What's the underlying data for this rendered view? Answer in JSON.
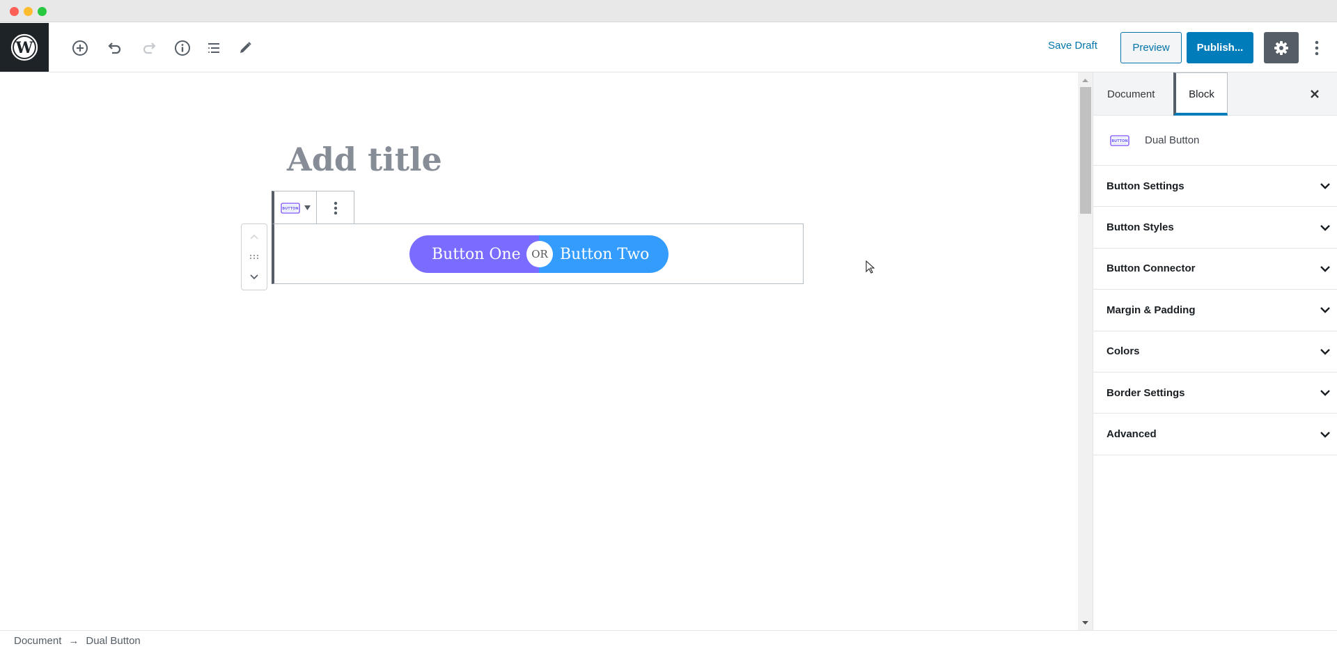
{
  "window": {
    "controls": [
      "close",
      "minimize",
      "maximize"
    ]
  },
  "header": {
    "logo": "wordpress-logo",
    "tools": [
      {
        "name": "add-block",
        "icon": "plus-circle-icon",
        "enabled": true
      },
      {
        "name": "undo",
        "icon": "undo-icon",
        "enabled": true
      },
      {
        "name": "redo",
        "icon": "redo-icon",
        "enabled": false
      },
      {
        "name": "content-structure",
        "icon": "info-icon",
        "enabled": true
      },
      {
        "name": "block-navigation",
        "icon": "list-icon",
        "enabled": true
      },
      {
        "name": "tools",
        "icon": "pencil-icon",
        "enabled": true
      }
    ],
    "save_draft_label": "Save Draft",
    "preview_label": "Preview",
    "publish_label": "Publish...",
    "settings_active": true
  },
  "editor": {
    "title_placeholder": "Add title",
    "block_toolbar": {
      "block_icon_text": "BUTTON"
    },
    "dual_button": {
      "button_one": "Button One",
      "connector": "OR",
      "button_two": "Button Two",
      "colors": {
        "button_one": "#7a6cfe",
        "button_two": "#339cfd"
      }
    }
  },
  "sidebar": {
    "tabs": [
      {
        "label": "Document",
        "active": false
      },
      {
        "label": "Block",
        "active": true
      }
    ],
    "block_card": {
      "title": "Dual Button",
      "icon_text": "BUTTON"
    },
    "panels": [
      {
        "label": "Button Settings"
      },
      {
        "label": "Button Styles"
      },
      {
        "label": "Button Connector"
      },
      {
        "label": "Margin & Padding"
      },
      {
        "label": "Colors"
      },
      {
        "label": "Border Settings"
      },
      {
        "label": "Advanced"
      }
    ]
  },
  "footer": {
    "breadcrumb": [
      "Document",
      "Dual Button"
    ],
    "separator": "→"
  },
  "colors": {
    "accent": "#007cba",
    "link": "#0073aa",
    "dark": "#1e2327"
  }
}
